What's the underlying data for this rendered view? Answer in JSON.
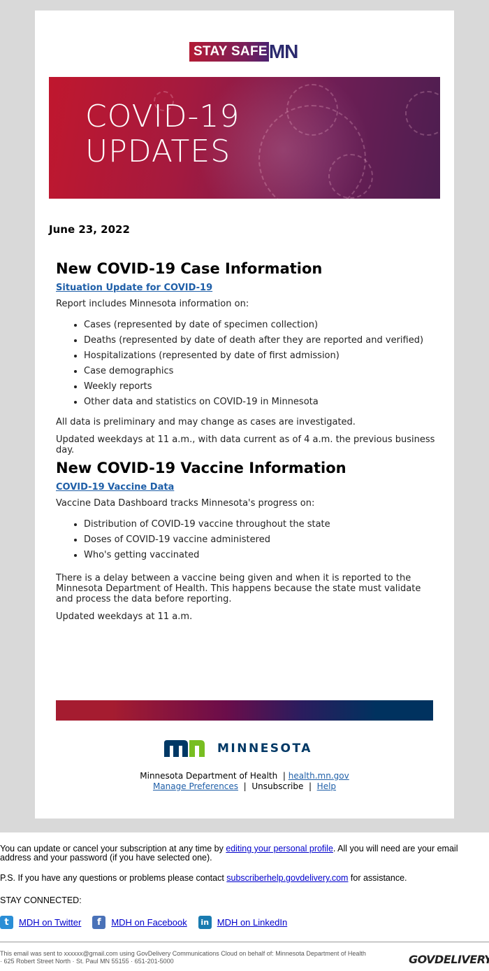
{
  "header": {
    "logo_stay_safe": "STAY SAFE",
    "logo_mn": "MN",
    "banner_line1": "COVID-19",
    "banner_line2": "UPDATES"
  },
  "date": "June 23, 2022",
  "case_section": {
    "heading": "New COVID-19 Case Information",
    "link": "Situation Update for COVID-19",
    "intro": "Report includes Minnesota information on:",
    "items": [
      "Cases (represented by date of specimen collection)",
      "Deaths (represented by date of death after they are reported and verified)",
      "Hospitalizations (represented by date of first admission)",
      "Case demographics",
      "Weekly reports",
      "Other data and statistics on COVID-19 in Minnesota"
    ],
    "note1": "All data is preliminary and may change as cases are investigated.",
    "note2": "Updated weekdays at 11 a.m., with data current as of 4 a.m. the previous business day."
  },
  "vaccine_section": {
    "heading": "New COVID-19 Vaccine Information",
    "link": "COVID-19 Vaccine Data",
    "intro": "Vaccine Data Dashboard tracks Minnesota's progress on:",
    "items": [
      "Distribution of COVID-19 vaccine throughout the state",
      "Doses of COVID-19 vaccine administered",
      "Who's getting vaccinated"
    ],
    "note1": "There is a delay between a vaccine being given and when it is reported to the Minnesota Department of Health. This happens because the state must validate and process the data before reporting.",
    "note2": "Updated weekdays at 11 a.m."
  },
  "footer": {
    "logo_word": "MINNESOTA",
    "org": "Minnesota Department of Health",
    "sep": "|",
    "site_link": "health.mn.gov",
    "manage": "Manage Preferences",
    "unsubscribe": "Unsubscribe",
    "help": "Help"
  },
  "subscription": {
    "text1_a": "You can update or cancel your subscription at any time by ",
    "text1_link": "editing your personal profile",
    "text1_b": ". All you will need are your email address and your password (if you have selected one).",
    "text2_a": "P.S. If you have any questions or problems please contact ",
    "text2_link": "subscriberhelp.govdelivery.com",
    "text2_b": " for assistance.",
    "stay_connected": "STAY CONNECTED:",
    "social": [
      {
        "icon": "twitter-icon",
        "glyph": "t",
        "color": "#2a8ed6",
        "label": "MDH on Twitter"
      },
      {
        "icon": "facebook-icon",
        "glyph": "f",
        "color": "#4a72b8",
        "label": "MDH on Facebook"
      },
      {
        "icon": "linkedin-icon",
        "glyph": "in",
        "color": "#1a7bb0",
        "label": "MDH on LinkedIn"
      }
    ]
  },
  "fine_print": {
    "line1": "This email was sent to xxxxxx@gmail.com using GovDelivery Communications Cloud on behalf of: Minnesota Department of Health",
    "line2": "· 625 Robert Street North · St. Paul MN 55155 · 651-201-5000",
    "brand": "GOVDELIVERY"
  }
}
